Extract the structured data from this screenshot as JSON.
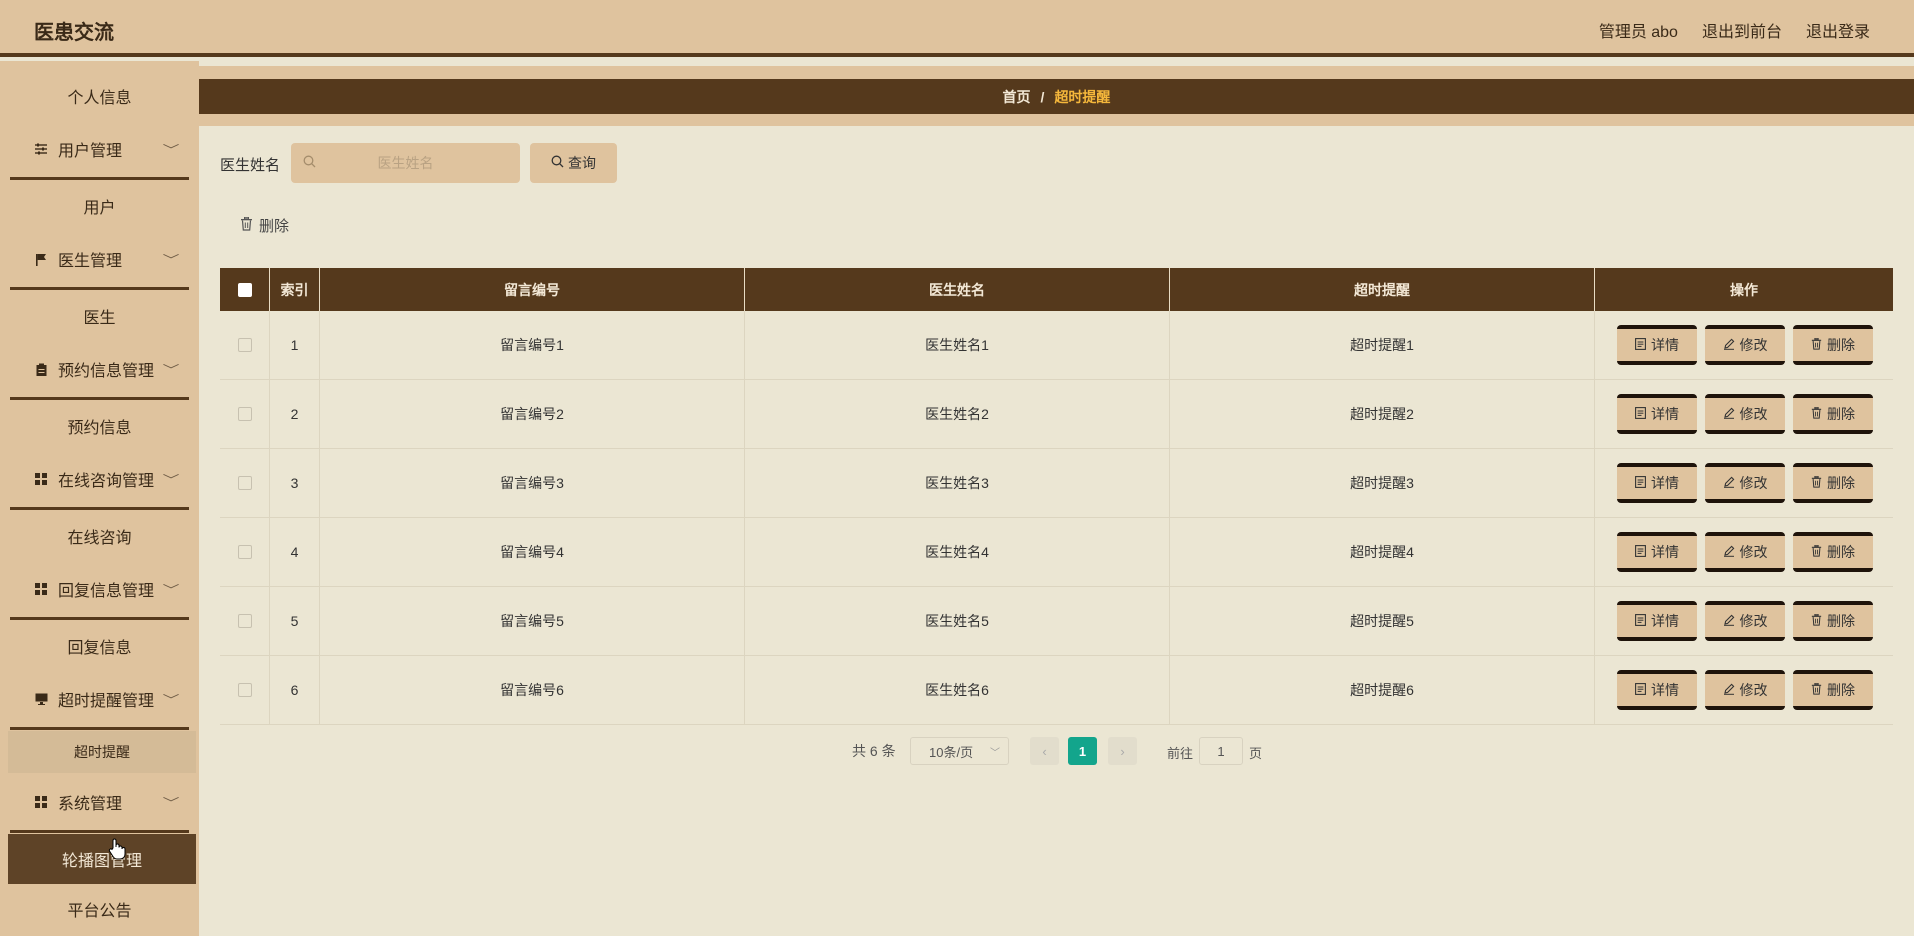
{
  "header": {
    "app_title": "医患交流",
    "links": [
      "管理员 abo",
      "退出到前台",
      "退出登录"
    ]
  },
  "sidebar": {
    "items": [
      {
        "label": "个人信息",
        "type": "sub"
      },
      {
        "label": "用户管理",
        "type": "group",
        "icon": "sliders-icon"
      },
      {
        "label": "用户",
        "type": "sub"
      },
      {
        "label": "医生管理",
        "type": "group",
        "icon": "flag-icon"
      },
      {
        "label": "医生",
        "type": "sub"
      },
      {
        "label": "预约信息管理",
        "type": "group",
        "icon": "clipboard-icon"
      },
      {
        "label": "预约信息",
        "type": "sub"
      },
      {
        "label": "在线咨询管理",
        "type": "group",
        "icon": "grid-icon"
      },
      {
        "label": "在线咨询",
        "type": "sub"
      },
      {
        "label": "回复信息管理",
        "type": "group",
        "icon": "grid-icon"
      },
      {
        "label": "回复信息",
        "type": "sub"
      },
      {
        "label": "超时提醒管理",
        "type": "group",
        "icon": "monitor-icon"
      },
      {
        "label": "超时提醒",
        "type": "sub",
        "active": true
      },
      {
        "label": "系统管理",
        "type": "group",
        "icon": "grid-icon"
      },
      {
        "label": "轮播图管理",
        "type": "sub",
        "hover": true
      },
      {
        "label": "平台公告",
        "type": "sub"
      }
    ]
  },
  "breadcrumb": {
    "home": "首页",
    "separator": "/",
    "current": "超时提醒"
  },
  "search": {
    "label": "医生姓名",
    "placeholder": "医生姓名",
    "value": "",
    "button": "查询"
  },
  "toolbar": {
    "delete": "删除"
  },
  "table": {
    "headers": [
      "索引",
      "留言编号",
      "医生姓名",
      "超时提醒",
      "操作"
    ],
    "rows": [
      {
        "index": "1",
        "msg_no": "留言编号1",
        "doctor": "医生姓名1",
        "reminder": "超时提醒1"
      },
      {
        "index": "2",
        "msg_no": "留言编号2",
        "doctor": "医生姓名2",
        "reminder": "超时提醒2"
      },
      {
        "index": "3",
        "msg_no": "留言编号3",
        "doctor": "医生姓名3",
        "reminder": "超时提醒3"
      },
      {
        "index": "4",
        "msg_no": "留言编号4",
        "doctor": "医生姓名4",
        "reminder": "超时提醒4"
      },
      {
        "index": "5",
        "msg_no": "留言编号5",
        "doctor": "医生姓名5",
        "reminder": "超时提醒5"
      },
      {
        "index": "6",
        "msg_no": "留言编号6",
        "doctor": "医生姓名6",
        "reminder": "超时提醒6"
      }
    ],
    "actions": {
      "detail": "详情",
      "edit": "修改",
      "delete": "删除"
    }
  },
  "pagination": {
    "total": "共 6 条",
    "page_size": "10条/页",
    "current_page": "1",
    "goto_label": "前往",
    "goto_value": "1",
    "goto_suffix": "页"
  },
  "colors": {
    "accent_dark": "#55391c",
    "accent_light": "#dfc39e",
    "page_bg": "#ebe6d3",
    "active_page": "#13a58c",
    "crumb_current": "#f5b73b"
  }
}
